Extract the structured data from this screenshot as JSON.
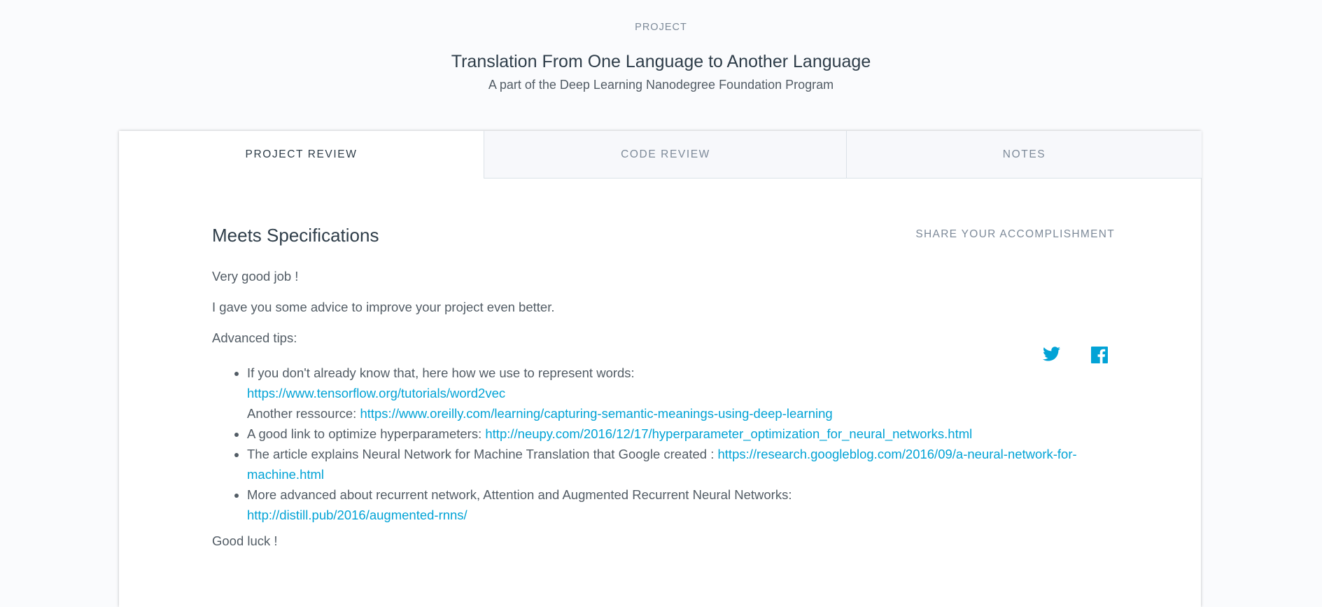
{
  "header": {
    "eyebrow": "PROJECT",
    "title": "Translation From One Language to Another Language",
    "subtitle": "A part of the Deep Learning Nanodegree Foundation Program"
  },
  "tabs": [
    {
      "label": "PROJECT REVIEW",
      "active": true
    },
    {
      "label": "CODE REVIEW",
      "active": false
    },
    {
      "label": "NOTES",
      "active": false
    }
  ],
  "review": {
    "heading": "Meets Specifications",
    "share_label": "SHARE YOUR ACCOMPLISHMENT",
    "share_icons": [
      "twitter-icon",
      "facebook-icon"
    ],
    "paragraphs": {
      "p1": "Very good job !",
      "p2": "I gave you some advice to improve your project even better.",
      "p3": "Advanced tips:",
      "closing": "Good luck !"
    },
    "tips": {
      "t1_text": "If you don't already know that, here how we use to represent words:",
      "t1_link": "https://www.tensorflow.org/tutorials/word2vec",
      "t1_text2": "Another ressource: ",
      "t1_link2": "https://www.oreilly.com/learning/capturing-semantic-meanings-using-deep-learning",
      "t2_text": "A good link to optimize hyperparameters: ",
      "t2_link": "http://neupy.com/2016/12/17/hyperparameter_optimization_for_neural_networks.html",
      "t3_text": "The article explains Neural Network for Machine Translation that Google created : ",
      "t3_link": "https://research.googleblog.com/2016/09/a-neural-network-for-machine.html",
      "t4_text": "More advanced about recurrent network, Attention and Augmented Recurrent Neural Networks:",
      "t4_link": "http://distill.pub/2016/augmented-rnns/"
    }
  },
  "colors": {
    "accent_link": "#02a3d6",
    "heading": "#2e3d49",
    "body_text": "#525c65",
    "muted": "#7d8a99",
    "page_bg": "#fafbfd"
  }
}
